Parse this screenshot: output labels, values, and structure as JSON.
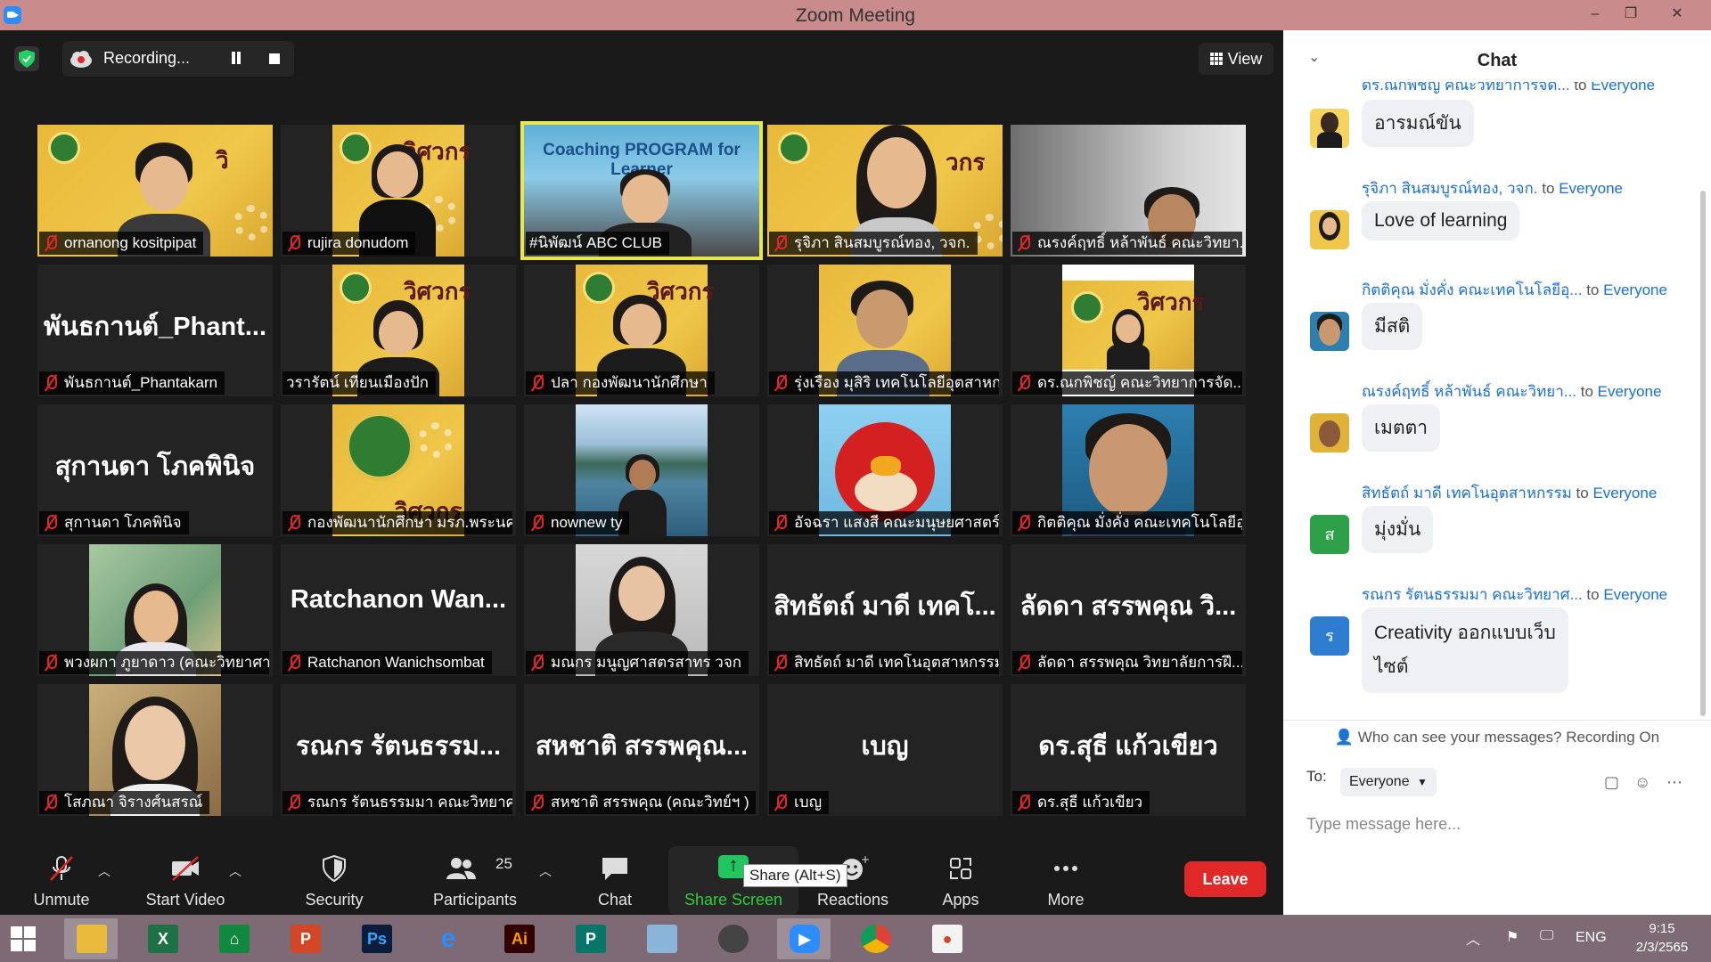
{
  "window": {
    "title": "Zoom Meeting",
    "minimize": "–",
    "restore": "❐",
    "close": "✕"
  },
  "recording": {
    "label": "Recording..."
  },
  "view_button": {
    "label": "View"
  },
  "tiles": [
    {
      "name": "ornanong kositpipat"
    },
    {
      "name": "rujira donudom"
    },
    {
      "name": "#นิพัฒน์ ABC CLUB",
      "video_text": "Coaching PROGRAM for Learner"
    },
    {
      "name": "รุจิภา สินสมบูรณ์ทอง, วจก."
    },
    {
      "name": "ณรงค์ฤทธิ์ หล้าพันธ์ คณะวิทยา..."
    },
    {
      "name": "พันธกานต์_Phantakarn",
      "big": "พันธกานต์_Phant..."
    },
    {
      "name": "วรารัตน์ เทียนเมืองปัก"
    },
    {
      "name": "ปลา กองพัฒนานักศึกษา"
    },
    {
      "name": "รุ่งเรือง มุสิริ เทคโนโลยีอุตสาหกร..."
    },
    {
      "name": "ดร.ณกพิชญ์ คณะวิทยาการจัด..."
    },
    {
      "name": "สุกานดา โภคพินิจ",
      "big": "สุกานดา โภคพินิจ"
    },
    {
      "name": "กองพัฒนานักศึกษา มรภ.พระนคร"
    },
    {
      "name": "nownew ty"
    },
    {
      "name": "อัจฉรา แสงสี คณะมนุษยศาสตร์ฯ"
    },
    {
      "name": "กิตติคุณ มั่งคั่ง คณะเทคโนโลยีอุ..."
    },
    {
      "name": "พวงผกา ภูยาดาว (คณะวิทยาศา..."
    },
    {
      "name": "Ratchanon Wanichsombat",
      "big": "Ratchanon Wan..."
    },
    {
      "name": "มณกร มนูญศาสตรสาทร วจก"
    },
    {
      "name": "สิทธัตถ์ มาดี เทคโนอุตสาหกรรม",
      "big": "สิทธัตถ์ มาดี เทคโ..."
    },
    {
      "name": "ลัดดา สรรพคุณ วิทยาลัยการฝึ...",
      "big": "ลัดดา สรรพคุณ วิ..."
    },
    {
      "name": "โสภณา จิรางศ์นสรณ์"
    },
    {
      "name": "รณกร รัตนธรรมมา คณะวิทยาศ...",
      "big": "รณกร รัตนธรรม..."
    },
    {
      "name": "สหชาติ สรรพคุณ (คณะวิทย์ฯ )",
      "big": "สหชาติ สรรพคุณ..."
    },
    {
      "name": "เบญ",
      "big": "เบญ"
    },
    {
      "name": "ดร.สุธี แก้วเขียว",
      "big": "ดร.สุธี แก้วเขียว"
    }
  ],
  "toolbar": {
    "unmute": "Unmute",
    "start_video": "Start Video",
    "security": "Security",
    "participants": "Participants",
    "participants_count": "25",
    "chat": "Chat",
    "share_screen": "Share Screen",
    "share_tooltip": "Share (Alt+S)",
    "reactions": "Reactions",
    "apps": "Apps",
    "more": "More",
    "leave": "Leave"
  },
  "chat": {
    "title": "Chat",
    "messages": [
      {
        "sender": "ดร.ณกพิชญ์ คณะวิทยาการจัด...",
        "to": "to",
        "recipient": "Everyone",
        "text": "อารมณ์ขัน"
      },
      {
        "sender": "รุจิภา สินสมบูรณ์ทอง, วจก.",
        "to": "to",
        "recipient": "Everyone",
        "text": "Love of learning"
      },
      {
        "sender": "กิตติคุณ มั่งคั่ง คณะเทคโนโลยีอุ...",
        "to": "to",
        "recipient": "Everyone",
        "text": "มีสติ"
      },
      {
        "sender": "ณรงค์ฤทธิ์ หล้าพันธ์ คณะวิทยา...",
        "to": "to",
        "recipient": "Everyone",
        "text": "เมตตา"
      },
      {
        "sender": "สิทธัตถ์ มาดี เทคโนอุตสาหกรรม",
        "to": "to",
        "recipient": "Everyone",
        "text": "มุ่งมั่น",
        "avatar_letter": "ส"
      },
      {
        "sender": "รณกร รัตนธรรมมา คณะวิทยาศ...",
        "to": "to",
        "recipient": "Everyone",
        "text": "Creativity ออกแบบเว็บ",
        "text2": "ไซต์",
        "avatar_letter": "ร"
      }
    ],
    "visibility_note": "Who can see your messages? Recording On",
    "to_label": "To:",
    "to_value": "Everyone",
    "input_placeholder": "Type message here..."
  },
  "taskbar": {
    "language": "ENG",
    "time": "9:15",
    "date": "2/3/2565"
  }
}
